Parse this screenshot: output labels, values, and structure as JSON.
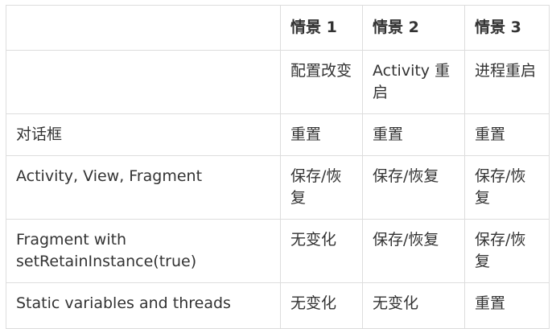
{
  "table": {
    "headers": [
      "",
      "情景 1",
      "情景 2",
      "情景 3"
    ],
    "subheader": [
      "",
      "配置改变",
      "Activity 重启",
      "进程重启"
    ],
    "rows": [
      {
        "label": "对话框",
        "s1": "重置",
        "s2": "重置",
        "s3": "重置"
      },
      {
        "label": "Activity, View, Fragment",
        "s1": "保存/恢复",
        "s2": "保存/恢复",
        "s3": "保存/恢复"
      },
      {
        "label": "Fragment with setRetainInstance(true)",
        "s1": "无变化",
        "s2": "保存/恢复",
        "s3": "保存/恢复"
      },
      {
        "label": "Static variables and threads",
        "s1": "无变化",
        "s2": "无变化",
        "s3": "重置"
      }
    ]
  }
}
